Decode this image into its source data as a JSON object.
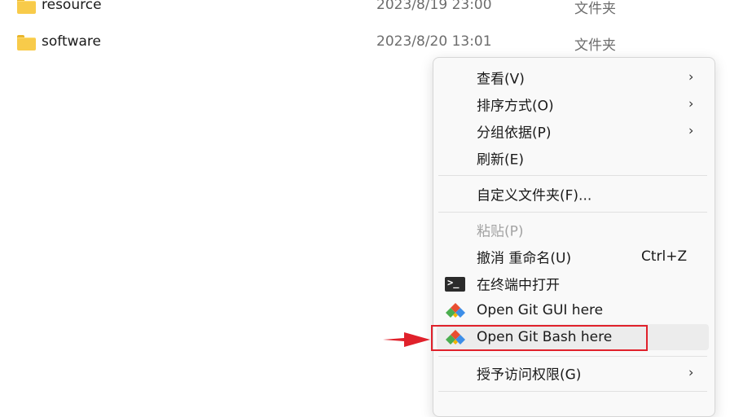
{
  "files": [
    {
      "name": "resource",
      "date": "2023/8/19 23:00",
      "type": "文件夹"
    },
    {
      "name": "software",
      "date": "2023/8/20 13:01",
      "type": "文件夹"
    }
  ],
  "context_menu": {
    "items": [
      {
        "label": "查看(V)",
        "submenu": true
      },
      {
        "label": "排序方式(O)",
        "submenu": true
      },
      {
        "label": "分组依据(P)",
        "submenu": true
      },
      {
        "label": "刷新(E)"
      },
      {
        "label": "自定义文件夹(F)..."
      },
      {
        "label": "粘贴(P)",
        "disabled": true
      },
      {
        "label": "撤消 重命名(U)",
        "shortcut": "Ctrl+Z"
      },
      {
        "label": "在终端中打开",
        "icon": "terminal-icon"
      },
      {
        "label": "Open Git GUI here",
        "icon": "git-icon"
      },
      {
        "label": "Open Git Bash here",
        "icon": "git-icon",
        "highlighted": true
      },
      {
        "label": "授予访问权限(G)",
        "submenu": true
      }
    ],
    "chevron": "›"
  },
  "annotation": {
    "arrow_color": "#e0212b",
    "box_color": "#e0212b"
  },
  "colors": {
    "folder": "#f8cb4a",
    "git_red": "#e94e31",
    "git_green": "#4bae4f",
    "git_blue": "#3d8ee8",
    "git_yellow": "#f5b400"
  }
}
